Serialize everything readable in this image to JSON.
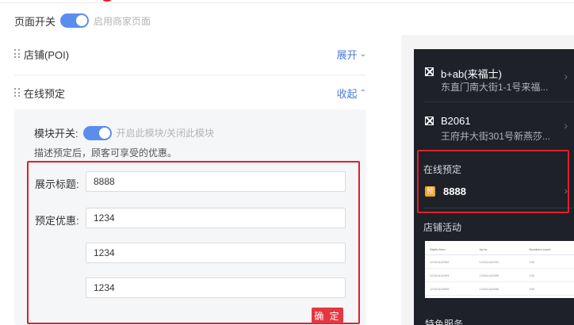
{
  "page_switch": {
    "label": "页面开关",
    "hint": "启用商家页面",
    "on": true
  },
  "sections": {
    "poi": {
      "title": "店铺(POI)",
      "toggle_label": "展开"
    },
    "booking": {
      "title": "在线预定",
      "toggle_label": "收起"
    }
  },
  "module": {
    "switch_label": "模块开关:",
    "switch_hint": "开启此模块/关闭此模块",
    "on": true,
    "description": "描述预定后，顾客可享受的优惠。"
  },
  "form": {
    "title_label": "展示标题:",
    "title_value": "8888",
    "discount_label": "预定优惠:",
    "discounts": [
      "1234",
      "1234",
      "1234"
    ],
    "confirm_label": "确 定"
  },
  "preview": {
    "stores": [
      {
        "name": "b+ab(来福士)",
        "address": "东直门南大街1-1号来福..."
      },
      {
        "name": "B2061",
        "address": "王府井大街301号新燕莎..."
      }
    ],
    "booking_title": "在线预定",
    "booking_badge": "预",
    "booking_value": "8888",
    "activity_title": "店铺活动",
    "activity_table": {
      "headers": [
        "Starts from",
        "Up to",
        "Numbers count"
      ],
      "rows": [
        [
          "12341442392",
          "12341442491",
          "100"
        ],
        [
          "12341442494",
          "12341442593",
          "100"
        ],
        [
          "12341442598",
          "12341442699",
          "100"
        ]
      ]
    },
    "bottom_title": "特色服务"
  },
  "colors": {
    "accent_blue": "#5b8def",
    "link_blue": "#4a7bd6",
    "highlight_red": "#e0202a",
    "confirm_red": "#e5373f",
    "phone_bg": "#1e2128",
    "badge_orange": "#f0a22f"
  }
}
